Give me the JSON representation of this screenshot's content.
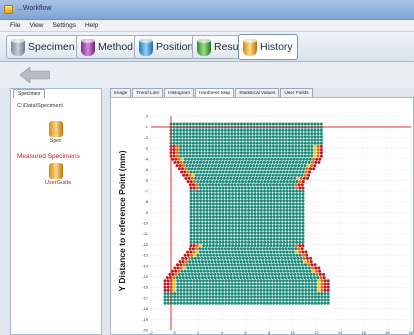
{
  "window": {
    "title": "...Workflow"
  },
  "menu": [
    "File",
    "View",
    "Settings",
    "Help"
  ],
  "toolbar": {
    "tabs": [
      {
        "label": "Specimen",
        "icon": "gray-cylinder-icon"
      },
      {
        "label": "Method",
        "icon": "purple-cylinder-icon"
      },
      {
        "label": "Position",
        "icon": "blue-cylinder-icon"
      },
      {
        "label": "Result",
        "icon": "green-cylinder-icon"
      },
      {
        "label": "History",
        "icon": "orange-cylinder-icon",
        "active": true
      }
    ]
  },
  "left_panel": {
    "tab": "Specimen",
    "path": "C:\\Data\\Specimen\\",
    "specimen_icon_label": "Spec",
    "measured_heading": "Measured Specimens",
    "map_icon_label": "UserGuide"
  },
  "content_tabs": [
    "Image",
    "Trend Line",
    "Histogram",
    "Hardness Map",
    "Statistical Values",
    "User Fields"
  ],
  "active_content_tab": "Hardness Map",
  "plot": {
    "y_axis_label": "Y Distance to reference Point (mm)",
    "y_ticks": [
      "0",
      "-1",
      "-2",
      "-3",
      "-4",
      "-5",
      "-6",
      "-7",
      "-8",
      "-9",
      "-10",
      "-11",
      "-12",
      "-13",
      "-14",
      "-15",
      "-16",
      "-17",
      "-18",
      "-19",
      "-20"
    ],
    "x_ticks": [
      "-2",
      "0",
      "2",
      "4",
      "6",
      "8",
      "10",
      "12",
      "14",
      "16",
      "18",
      "20"
    ]
  },
  "colors": {
    "map_body": "#1a8a78",
    "map_edge_hot": "#c01818",
    "map_edge_warm": "#e06a10",
    "map_edge_yellow": "#e8c820",
    "reference_line": "#d43030"
  }
}
